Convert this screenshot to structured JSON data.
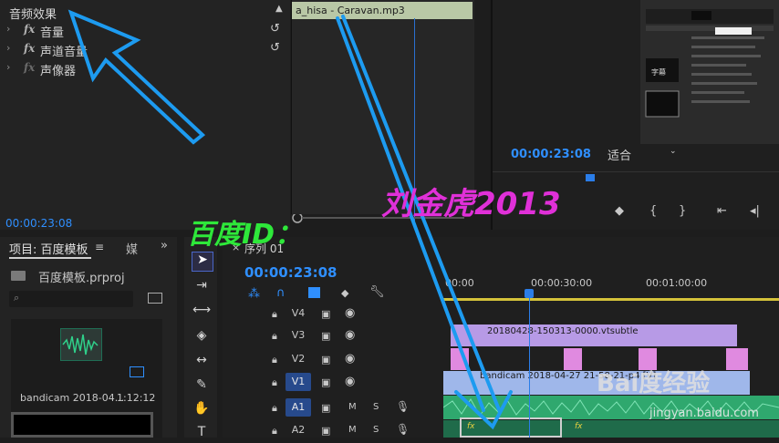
{
  "effects": {
    "header": "音频效果",
    "items": [
      {
        "fx": "fx",
        "label": "音量",
        "reset": "↺"
      },
      {
        "fx": "fx",
        "label": "声道音量",
        "reset": "↺"
      },
      {
        "fx": "fx",
        "label": "声像器",
        "reset": ""
      }
    ],
    "clip_name": "a_hisa - Caravan.mp3",
    "time": "00:00:23:08"
  },
  "program": {
    "time": "00:00:23:08",
    "fit": "适合",
    "transport_icons": [
      "marker-icon",
      "in-point-icon",
      "out-point-icon",
      "go-to-in-icon",
      "step-back-icon"
    ]
  },
  "project": {
    "tab": "项目: 百度模板",
    "media_tab": "媒",
    "file": "百度模板.prproj",
    "thumb_name": "bandicam 2018-04...",
    "thumb_duration": "1:12:12"
  },
  "timeline": {
    "tab_close": "×",
    "tab": "序列 01",
    "time": "00:00:23:08",
    "ruler_labels": [
      "00:00",
      "00:00:30:00",
      "00:01:00:00"
    ],
    "tracks": [
      {
        "name": "V4",
        "type": "video",
        "highlight": false
      },
      {
        "name": "V3",
        "type": "video",
        "highlight": false
      },
      {
        "name": "V2",
        "type": "video",
        "highlight": false
      },
      {
        "name": "V1",
        "type": "video",
        "highlight": true
      },
      {
        "name": "A1",
        "type": "audio",
        "highlight": true,
        "m": "M",
        "s": "S"
      },
      {
        "name": "A2",
        "type": "audio",
        "highlight": false,
        "m": "M",
        "s": "S"
      }
    ],
    "clips": {
      "subtitle": "20180428-150313-0000.vtsubtle",
      "video": "bandicam 2018-04-27 21-58-21-",
      "video_ext": "p4 [V]",
      "fx": "fx"
    }
  },
  "overlay": {
    "left_text": "百度ID：",
    "right_text": "刘金虎2013",
    "watermark": "Bai度经验",
    "watermark_url": "jingyan.baidu.com"
  },
  "colors": {
    "accent_blue": "#2f8fff",
    "subtitle_clip": "#b79ae6",
    "video_clip": "#9fb7ea",
    "audio_clip": "#2fa86e",
    "overlay_green": "#2ee83a",
    "overlay_magenta": "#e030d8",
    "arrow_blue": "#1d9bf0"
  }
}
